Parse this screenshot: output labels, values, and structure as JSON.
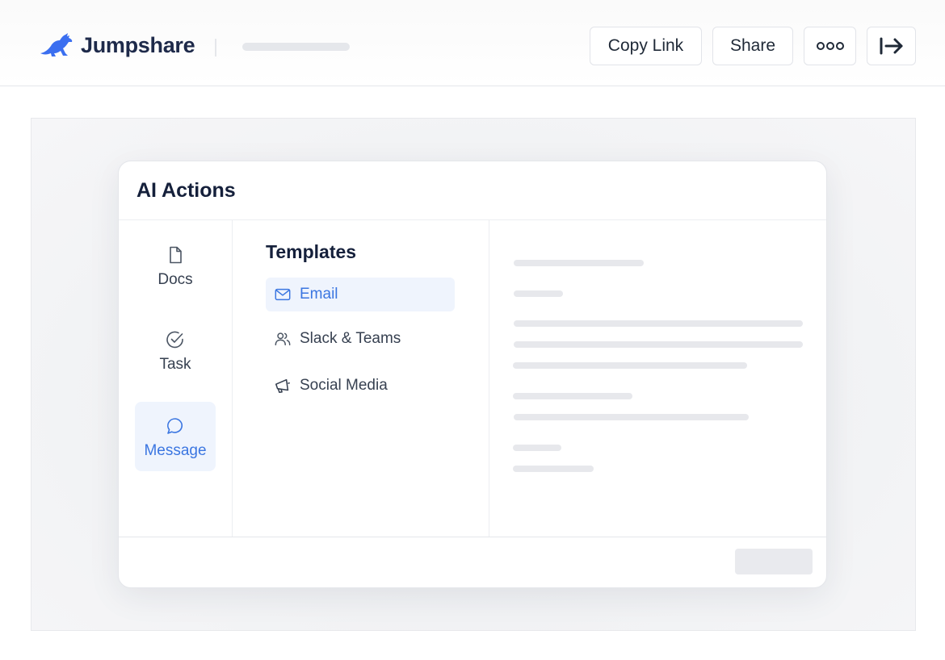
{
  "header": {
    "brand_name": "Jumpshare",
    "copy_link_label": "Copy Link",
    "share_label": "Share",
    "more_icon": "more-horizontal-icon",
    "exit_icon": "exit-arrow-icon",
    "logo_icon": "kangaroo-logo-icon"
  },
  "panel": {
    "title": "AI Actions",
    "sidebar": [
      {
        "label": "Docs",
        "icon": "document-icon",
        "active": false
      },
      {
        "label": "Task",
        "icon": "check-circle-icon",
        "active": false
      },
      {
        "label": "Message",
        "icon": "chat-bubble-icon",
        "active": true
      }
    ],
    "templates": {
      "heading": "Templates",
      "items": [
        {
          "label": "Email",
          "icon": "mail-icon",
          "active": true
        },
        {
          "label": "Slack & Teams",
          "icon": "users-icon",
          "active": false
        },
        {
          "label": "Social Media",
          "icon": "megaphone-icon",
          "active": false
        }
      ]
    }
  },
  "colors": {
    "brand": "#1e2a4a",
    "logo_blue": "#3b6ff0",
    "accent": "#3b76e1",
    "active_bg": "#eff4fd",
    "placeholder": "#e7e8ec"
  }
}
